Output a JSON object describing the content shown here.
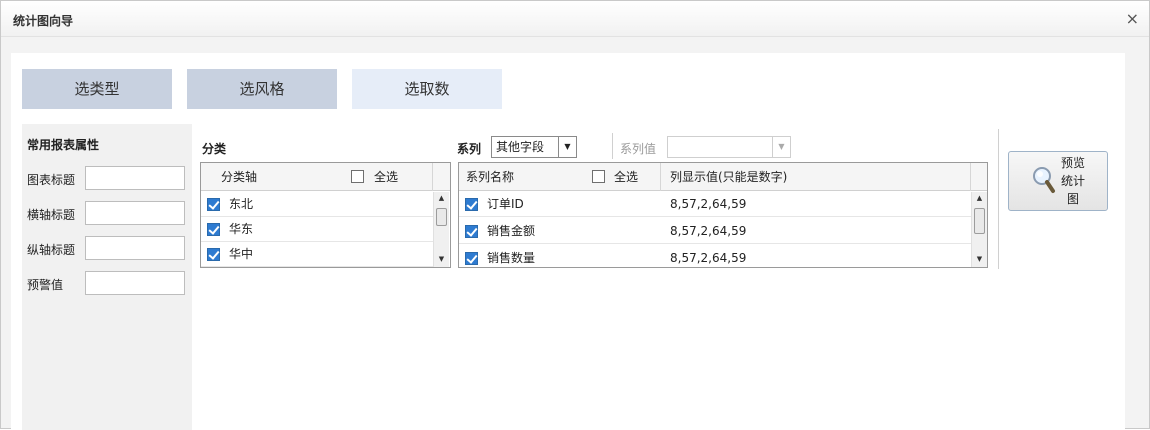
{
  "dialog": {
    "title": "统计图向导",
    "close_label": "×"
  },
  "steps": [
    "选类型",
    "选风格",
    "选取数"
  ],
  "properties": {
    "heading": "常用报表属性",
    "fields": [
      {
        "label": "图表标题",
        "value": ""
      },
      {
        "label": "横轴标题",
        "value": ""
      },
      {
        "label": "纵轴标题",
        "value": ""
      },
      {
        "label": "预警值",
        "value": ""
      }
    ]
  },
  "category": {
    "label": "分类",
    "column_header": "分类轴",
    "select_all_label": "全选",
    "items": [
      {
        "name": "东北",
        "checked": true
      },
      {
        "name": "华东",
        "checked": true
      },
      {
        "name": "华中",
        "checked": true
      }
    ]
  },
  "series": {
    "label": "系列",
    "field_select": "其他字段",
    "value_label": "系列值",
    "value_select": "",
    "name_header": "系列名称",
    "select_all_label": "全选",
    "values_header": "列显示值(只能是数字)",
    "items": [
      {
        "name": "订单ID",
        "values": "8,57,2,64,59",
        "checked": true
      },
      {
        "name": "销售金额",
        "values": "8,57,2,64,59",
        "checked": true
      },
      {
        "name": "销售数量",
        "values": "8,57,2,64,59",
        "checked": true
      }
    ]
  },
  "preview_button": {
    "line1": "预览",
    "line2": "统计",
    "line3": "图"
  }
}
